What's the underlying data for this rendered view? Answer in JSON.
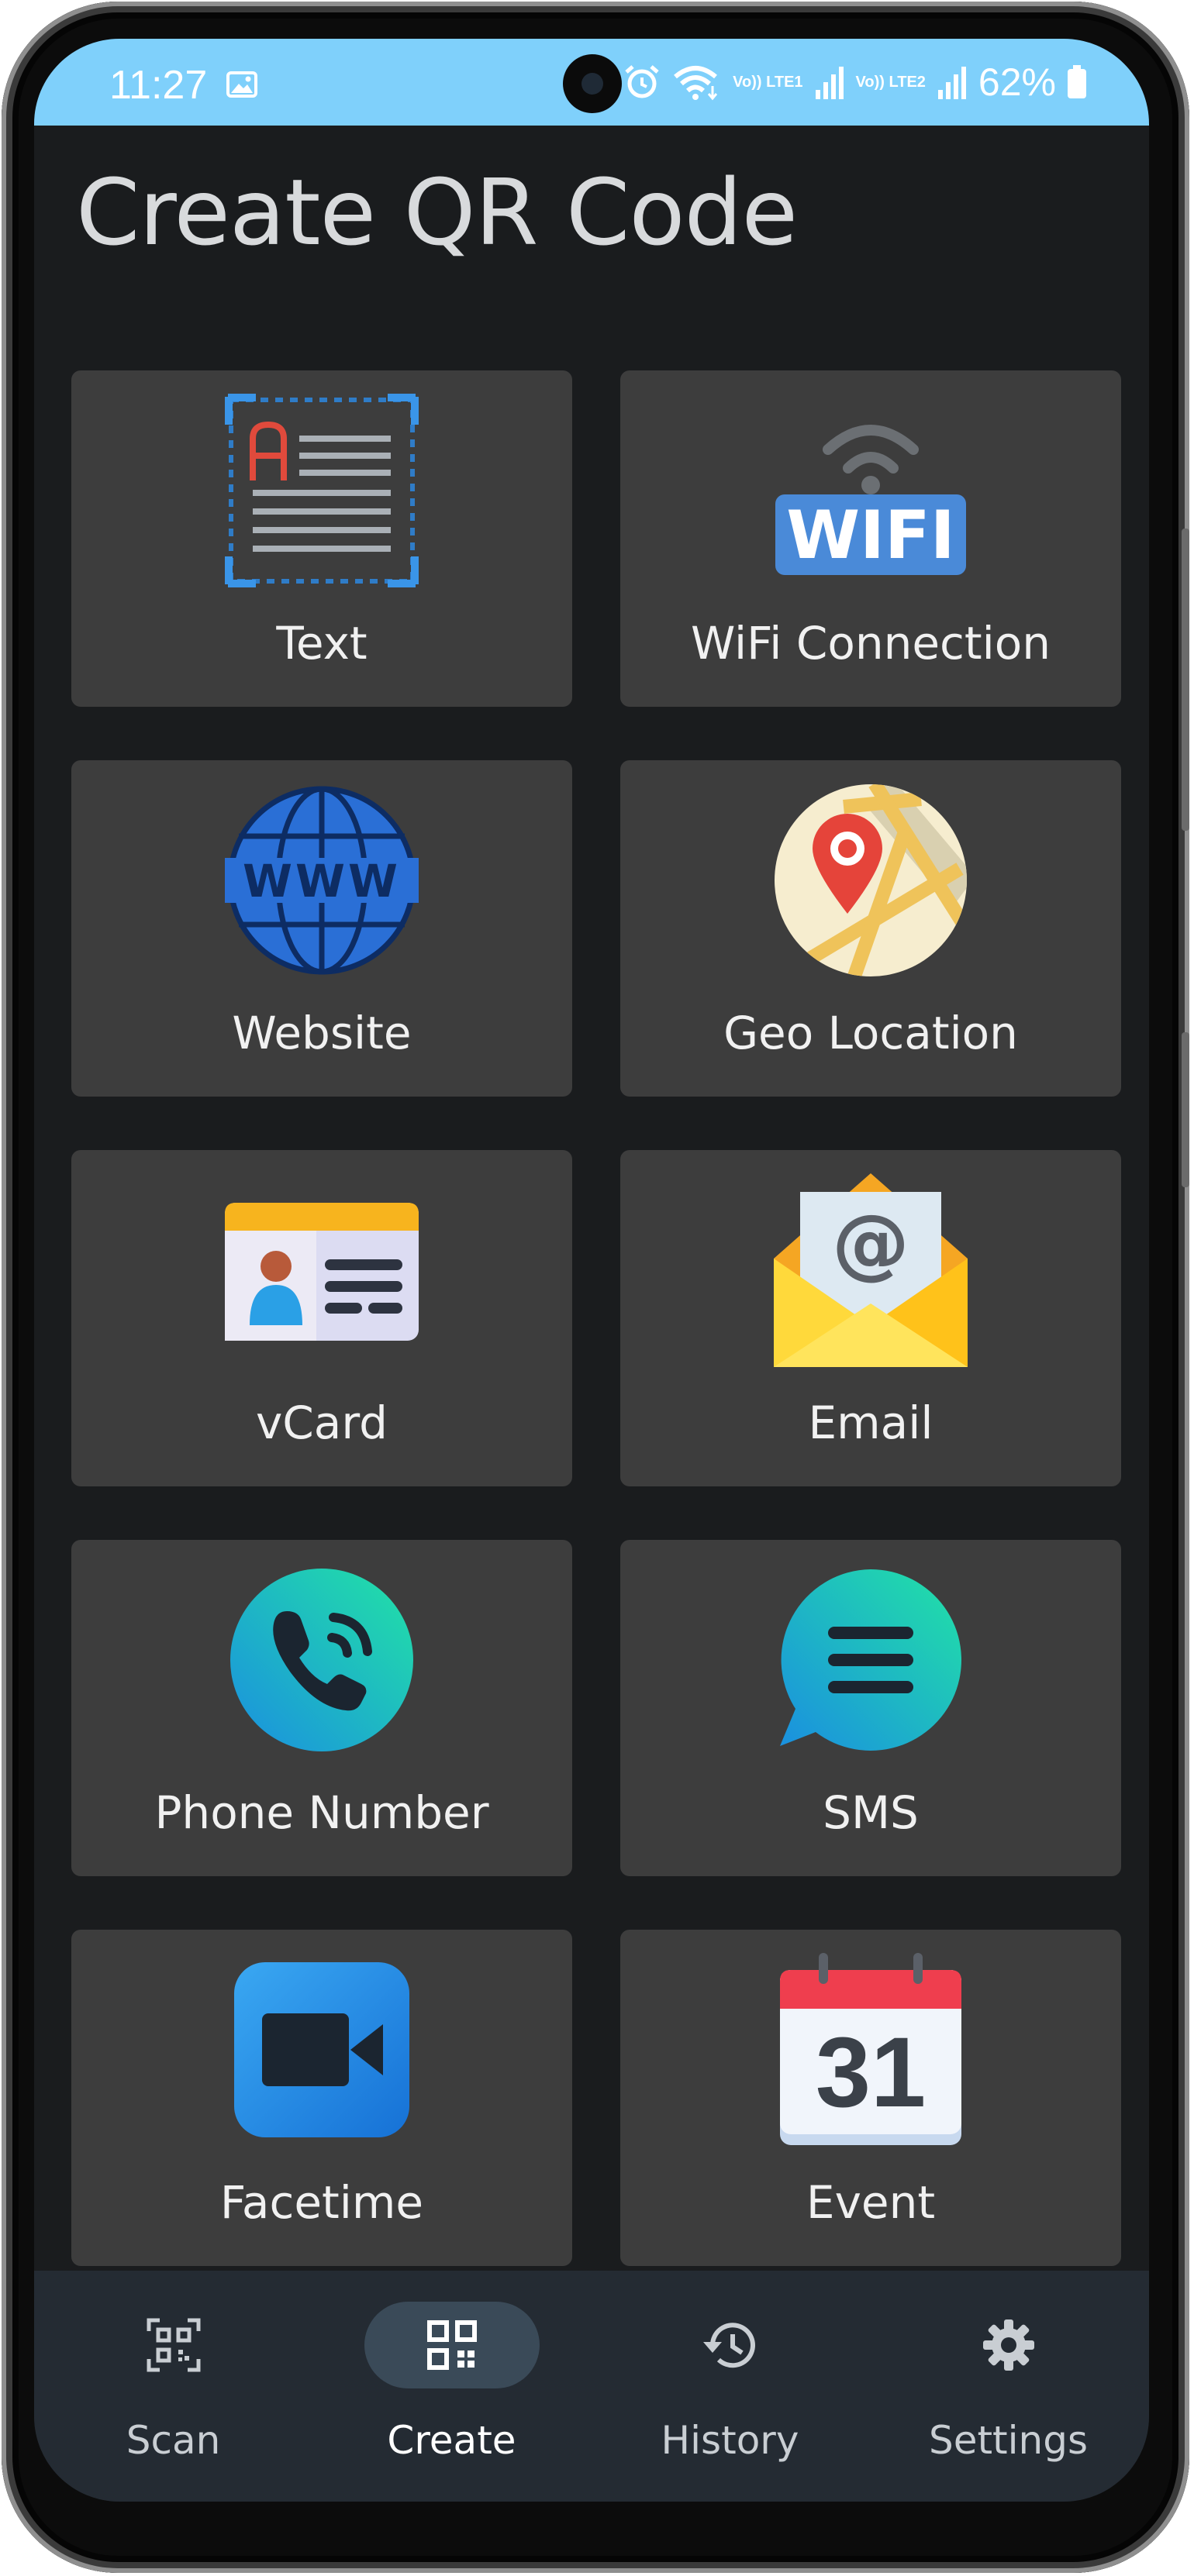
{
  "status_bar": {
    "time": "11:27",
    "network_1": "Vo)) LTE1",
    "network_2": "Vo)) LTE2",
    "battery": "62%"
  },
  "page": {
    "title": "Create QR Code"
  },
  "options": [
    {
      "label": "Text",
      "icon": "text-document-icon"
    },
    {
      "label": "WiFi Connection",
      "icon": "wifi-icon"
    },
    {
      "label": "Website",
      "icon": "globe-www-icon"
    },
    {
      "label": "Geo Location",
      "icon": "map-pin-icon"
    },
    {
      "label": "vCard",
      "icon": "contact-card-icon"
    },
    {
      "label": "Email",
      "icon": "envelope-at-icon"
    },
    {
      "label": "Phone Number",
      "icon": "phone-icon"
    },
    {
      "label": "SMS",
      "icon": "chat-bubble-icon"
    },
    {
      "label": "Facetime",
      "icon": "video-camera-icon"
    },
    {
      "label": "Event",
      "icon": "calendar-icon"
    }
  ],
  "calendar_day": "31",
  "wifi_badge": "WIFI",
  "www_text": "WWW",
  "nav": {
    "items": [
      {
        "label": "Scan",
        "icon": "qr-scan-icon"
      },
      {
        "label": "Create",
        "icon": "qr-grid-icon",
        "selected": true
      },
      {
        "label": "History",
        "icon": "history-icon"
      },
      {
        "label": "Settings",
        "icon": "gear-icon"
      }
    ]
  },
  "colors": {
    "status_bar": "#7fd0fb",
    "background": "#1a1c1e",
    "card": "#3d3d3d",
    "bottom_nav": "#242b33",
    "nav_selected_pill": "#3a4a58"
  }
}
